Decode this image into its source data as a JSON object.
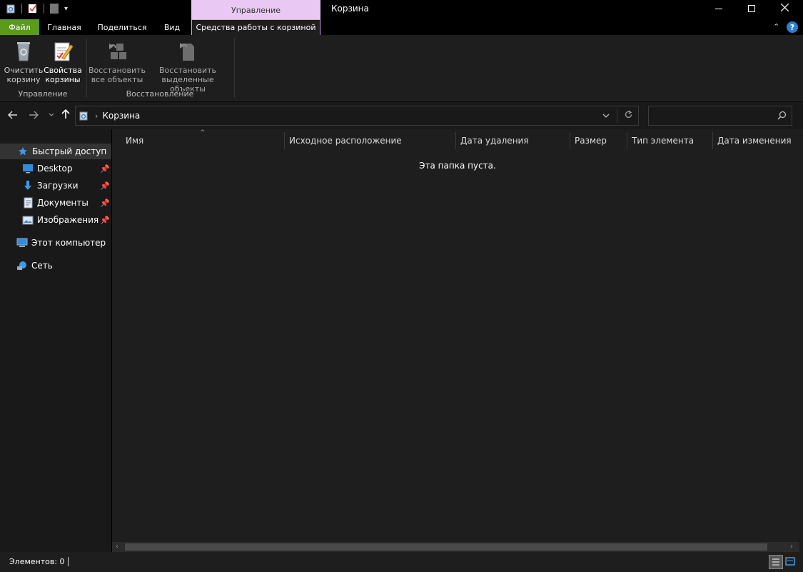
{
  "window": {
    "title": "Корзина",
    "context_tab_header": "Управление"
  },
  "controls": {
    "minimize_icon": "minimize-icon",
    "maximize_icon": "maximize-icon",
    "close_icon": "close-icon"
  },
  "ribbon_tabs": {
    "file": "Файл",
    "home": "Главная",
    "share": "Поделиться",
    "view": "Вид",
    "recycle_tools": "Средства работы с корзиной"
  },
  "ribbon": {
    "empty_bin_line1": "Очистить",
    "empty_bin_line2": "корзину",
    "bin_props_line1": "Свойства",
    "bin_props_line2": "корзины",
    "restore_all_line1": "Восстановить",
    "restore_all_line2": "все объекты",
    "restore_sel_line1": "Восстановить",
    "restore_sel_line2": "выделенные объекты",
    "group_manage": "Управление",
    "group_restore": "Восстановление"
  },
  "address": {
    "path": "Корзина",
    "search_placeholder": ""
  },
  "nav": {
    "quick_access": "Быстрый доступ",
    "desktop": "Desktop",
    "downloads": "Загрузки",
    "documents": "Документы",
    "pictures": "Изображения",
    "this_pc": "Этот компьютер",
    "network": "Сеть"
  },
  "columns": {
    "name": "Имя",
    "original_location": "Исходное расположение",
    "date_deleted": "Дата удаления",
    "size": "Размер",
    "item_type": "Тип элемента",
    "date_modified": "Дата изменения"
  },
  "content": {
    "empty_message": "Эта папка пуста."
  },
  "status": {
    "items": "Элементов: 0"
  },
  "colors": {
    "file_tab": "#5b9b1c",
    "context_header": "#e9c9f3",
    "accent_blue": "#3b9bea"
  }
}
